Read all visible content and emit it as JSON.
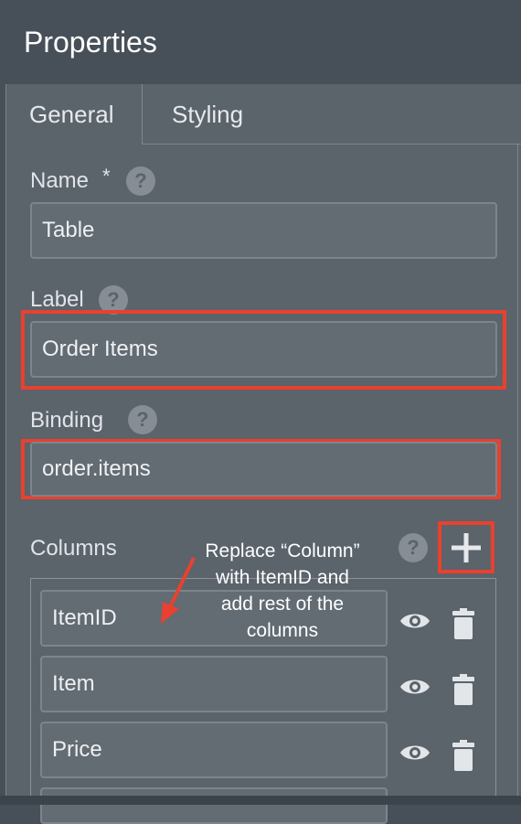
{
  "header": {
    "title": "Properties"
  },
  "tabs": {
    "general": "General",
    "styling": "Styling"
  },
  "fields": {
    "name": {
      "label": "Name",
      "required_mark": "*",
      "value": "Table"
    },
    "label": {
      "label": "Label",
      "value": "Order Items"
    },
    "binding": {
      "label": "Binding",
      "value": "order.items"
    },
    "columns": {
      "label": "Columns"
    }
  },
  "column_rows": [
    {
      "value": "ItemID"
    },
    {
      "value": "Item"
    },
    {
      "value": "Price"
    }
  ],
  "annotation": {
    "line1": "Replace “Column”",
    "line2": "with ItemID and",
    "line3": "add rest of the",
    "line4": "columns"
  },
  "icons": {
    "help": "question-circle-icon",
    "add": "plus-icon",
    "visibility": "eye-icon",
    "delete": "trash-icon"
  },
  "colors": {
    "highlight": "#e8412f",
    "panel": "#5b636b",
    "header": "#474f58"
  }
}
